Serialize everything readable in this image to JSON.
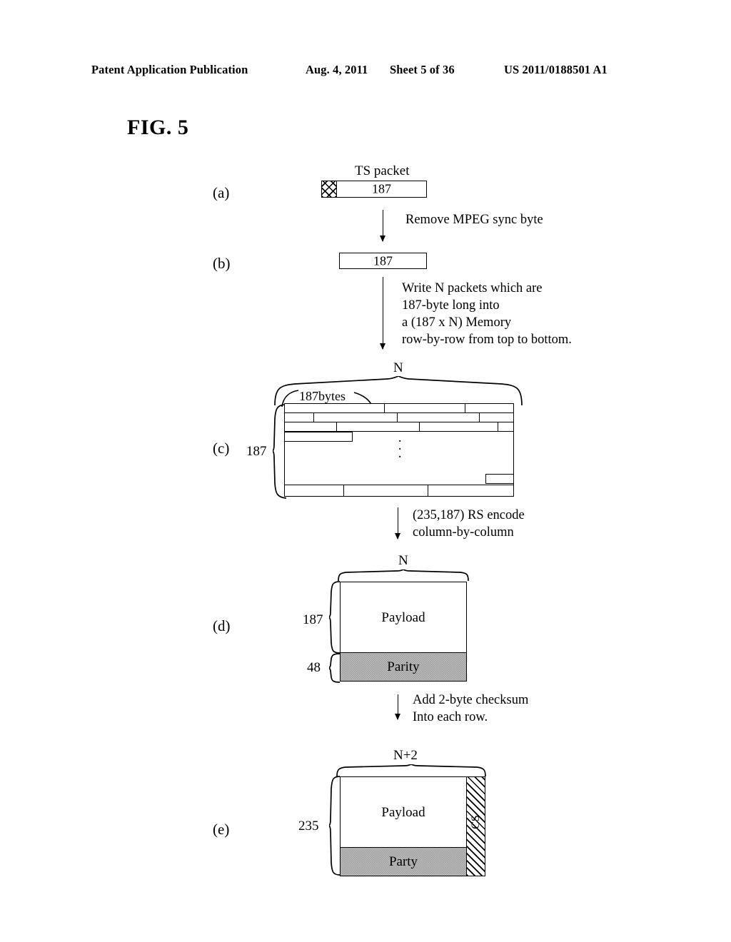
{
  "header": {
    "publication": "Patent Application Publication",
    "date": "Aug. 4, 2011",
    "sheet": "Sheet 5 of 36",
    "patent_number": "US 2011/0188501 A1"
  },
  "figure": {
    "title": "FIG. 5"
  },
  "steps": {
    "a": {
      "label": "(a)",
      "caption": "TS packet",
      "box_value": "187",
      "sync_byte_name": "MPEG sync byte"
    },
    "b": {
      "label": "(b)",
      "box_value": "187"
    },
    "c": {
      "label": "(c)",
      "top_dim": "N",
      "left_dim": "187",
      "row_label": "187bytes",
      "ellipsis": "·"
    },
    "d": {
      "label": "(d)",
      "top_dim": "N",
      "left_dim_payload": "187",
      "left_dim_parity": "48",
      "payload": "Payload",
      "parity": "Parity"
    },
    "e": {
      "label": "(e)",
      "top_dim": "N+2",
      "left_dim": "235",
      "payload": "Payload",
      "parity": "Party",
      "checksum_strip": "CS"
    }
  },
  "annotations": {
    "a_to_b": "Remove MPEG sync byte",
    "b_to_c": "Write N packets which are\n187-byte long into\na (187 x N) Memory\nrow-by-row from top to bottom.",
    "c_to_d": "(235,187) RS encode\ncolumn-by-column",
    "d_to_e": "Add 2-byte checksum\nInto each row."
  },
  "colors": {
    "ink": "#000000",
    "paper": "#ffffff",
    "parity_fill": "#d6d6d6"
  }
}
